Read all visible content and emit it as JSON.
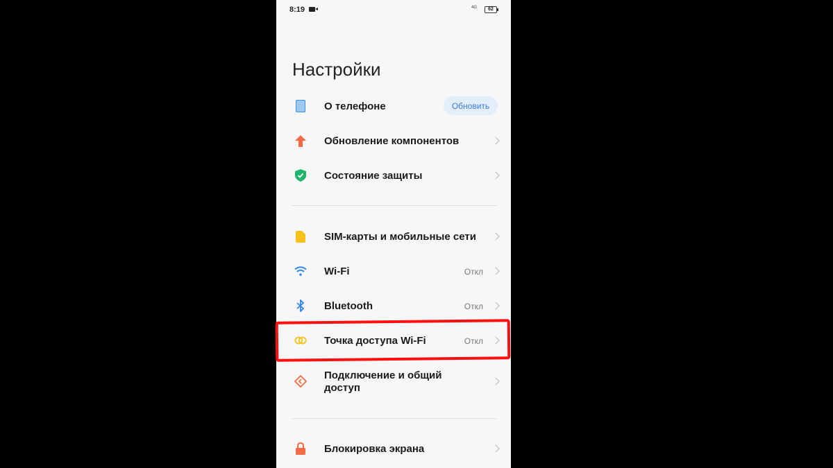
{
  "status_bar": {
    "time": "8:19",
    "signal": "4G",
    "battery": "62"
  },
  "page": {
    "title": "Настройки"
  },
  "items": [
    {
      "label": "О телефоне",
      "action": "Обновить",
      "icon": "phone-icon"
    },
    {
      "label": "Обновление компонентов",
      "icon": "arrow-up-icon"
    },
    {
      "label": "Состояние защиты",
      "icon": "shield-icon"
    },
    {
      "label": "SIM-карты и мобильные сети",
      "icon": "sim-icon"
    },
    {
      "label": "Wi-Fi",
      "value": "Откл",
      "icon": "wifi-icon"
    },
    {
      "label": "Bluetooth",
      "value": "Откл",
      "icon": "bluetooth-icon"
    },
    {
      "label": "Точка доступа Wi-Fi",
      "value": "Откл",
      "icon": "hotspot-icon"
    },
    {
      "label_line1": "Подключение и общий",
      "label_line2": "доступ",
      "icon": "share-icon"
    },
    {
      "label": "Блокировка экрана",
      "icon": "lock-icon"
    }
  ],
  "colors": {
    "accent": "#3a7ae0",
    "highlight": "#ff1010",
    "icon_orange": "#f26b45",
    "icon_green": "#1fb36b",
    "icon_yellow": "#f5c21b",
    "icon_blue": "#2f86e8"
  }
}
